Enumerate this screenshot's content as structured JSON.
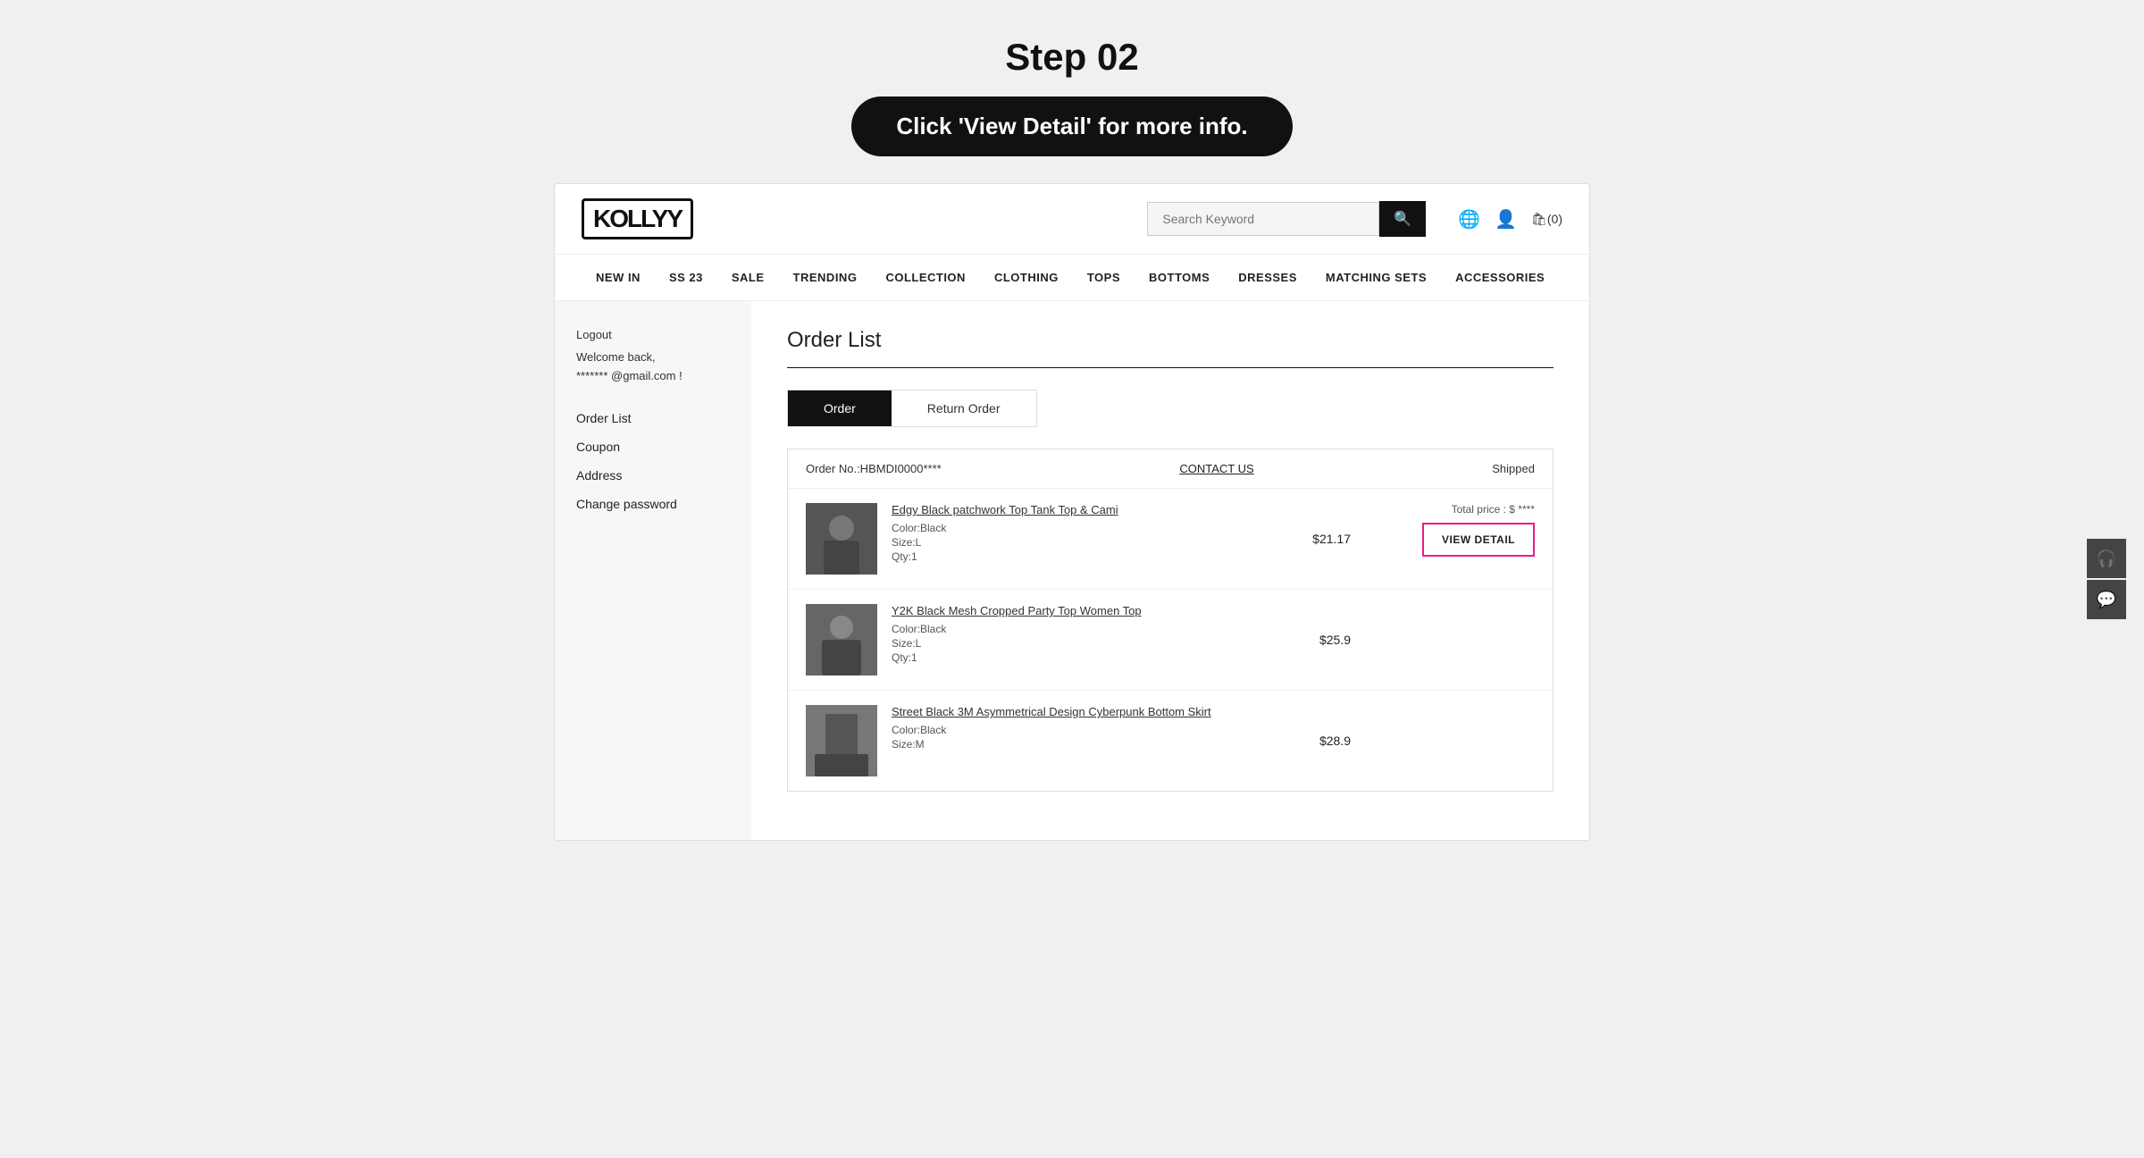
{
  "instruction": {
    "step": "Step 02",
    "subtitle": "Click 'View Detail' for more info."
  },
  "header": {
    "logo": "KOLLYY",
    "search_placeholder": "Search Keyword",
    "search_btn_icon": "🔍",
    "globe_icon": "🌐",
    "user_icon": "👤",
    "cart_label": "⬛(0)"
  },
  "nav": {
    "items": [
      {
        "label": "NEW IN"
      },
      {
        "label": "SS 23"
      },
      {
        "label": "SALE"
      },
      {
        "label": "TRENDING"
      },
      {
        "label": "COLLECTION"
      },
      {
        "label": "CLOTHING"
      },
      {
        "label": "TOPS"
      },
      {
        "label": "BOTTOMS"
      },
      {
        "label": "DRESSES"
      },
      {
        "label": "MATCHING SETS"
      },
      {
        "label": "ACCESSORIES"
      }
    ]
  },
  "sidebar": {
    "logout_label": "Logout",
    "welcome_label": "Welcome back,",
    "email_label": "******* @gmail.com !",
    "menu_items": [
      {
        "label": "Order List"
      },
      {
        "label": "Coupon"
      },
      {
        "label": "Address"
      },
      {
        "label": "Change password"
      }
    ]
  },
  "main": {
    "page_title": "Order List",
    "tabs": [
      {
        "label": "Order",
        "active": true
      },
      {
        "label": "Return Order",
        "active": false
      }
    ],
    "order_card": {
      "order_number": "Order No.:HBMDI0000****",
      "contact_us": "CONTACT US",
      "status": "Shipped",
      "items": [
        {
          "name": "Edgy Black patchwork Top Tank Top & Cami",
          "color": "Color:Black",
          "size": "Size:L",
          "qty": "Qty:1",
          "price": "$21.17",
          "total_price_label": "Total price : $ ****",
          "view_detail_label": "VIEW DETAIL",
          "has_view_detail": true
        },
        {
          "name": "Y2K Black Mesh Cropped Party Top Women Top",
          "color": "Color:Black",
          "size": "Size:L",
          "qty": "Qty:1",
          "price": "$25.9",
          "has_view_detail": false
        },
        {
          "name": "Street Black 3M Asymmetrical Design Cyberpunk Bottom Skirt",
          "color": "Color:Black",
          "size": "Size:M",
          "qty": "",
          "price": "$28.9",
          "has_view_detail": false
        }
      ]
    }
  },
  "float_buttons": [
    {
      "icon": "🎧",
      "name": "headphone-icon"
    },
    {
      "icon": "💬",
      "name": "chat-icon"
    }
  ]
}
